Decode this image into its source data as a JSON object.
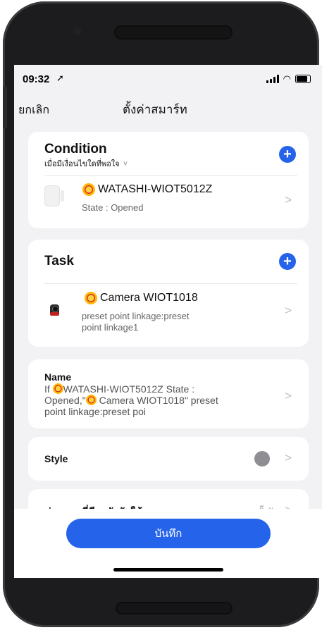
{
  "status_bar": {
    "time": "09:32"
  },
  "nav": {
    "cancel_label": "ยกเลิก",
    "title": "ตั้งค่าสมาร์ท"
  },
  "condition": {
    "title": "Condition",
    "subtitle": "เมื่อมีเงื่อนไขใดที่พอใจ",
    "device": {
      "name": "WATASHI-WIOT5012Z",
      "state": "State : Opened"
    }
  },
  "task": {
    "title": "Task",
    "device": {
      "name": "Camera WIOT1018",
      "action_line1": "preset point linkage:preset",
      "action_line2": "point  linkage1"
    }
  },
  "name_section": {
    "label": "Name",
    "line1_prefix": "If ",
    "line1_text": "WATASHI-WIOT5012Z State :",
    "line2_prefix": "Opened,\"",
    "line2_text": " Camera WIOT1018\" preset",
    "line3": "point linkage:preset poi"
  },
  "style_section": {
    "label": "Style",
    "color": "#8e8e93"
  },
  "schedule_section": {
    "label": "ช่วงเวลาที่มีผลบังคับใช้",
    "value": "ทั้งวัน"
  },
  "save_label": "บันทึก",
  "colors": {
    "accent": "#2563eb"
  },
  "icons": {
    "add": "plus-icon",
    "chevron": "chevron-right-icon"
  }
}
